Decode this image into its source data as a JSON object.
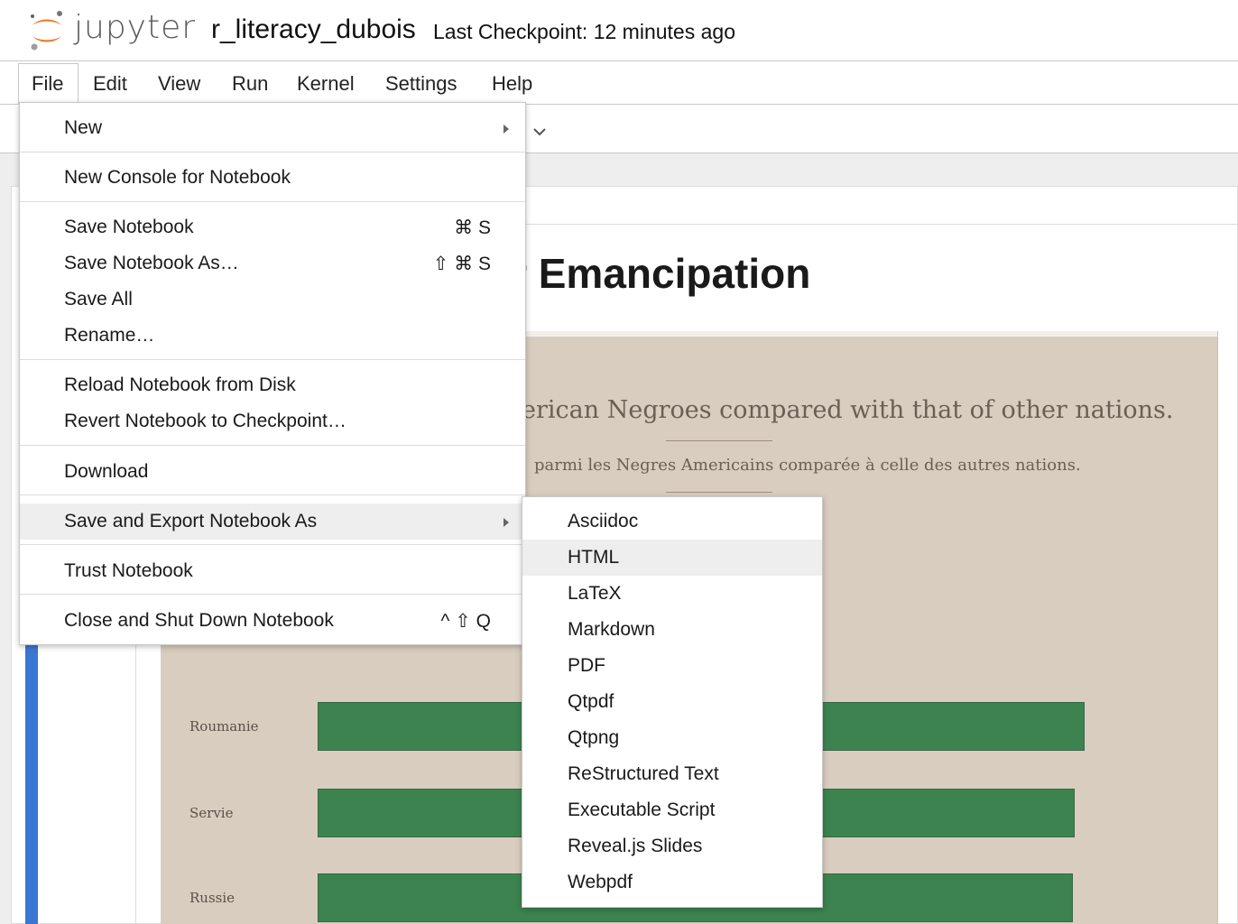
{
  "header": {
    "logo_text": "jupyter",
    "notebook_title": "r_literacy_dubois",
    "checkpoint": "Last Checkpoint: 12 minutes ago"
  },
  "menubar": {
    "items": [
      "File",
      "Edit",
      "View",
      "Run",
      "Kernel",
      "Settings",
      "Help"
    ],
    "active": "File"
  },
  "notebook": {
    "heading_visible": "teracy After Emancipation",
    "scan": {
      "line1": "erican Negroes compared with that of other nations.",
      "line2": "parmi les Negres Americains comparée à celle des autres nations.",
      "labels": [
        "Roumanie",
        "Servie",
        "Russie"
      ]
    }
  },
  "file_menu": {
    "items": [
      {
        "label": "New",
        "submenu": true
      },
      {
        "label": "New Console for Notebook"
      },
      {
        "label": "Save Notebook",
        "shortcut": "⌘ S"
      },
      {
        "label": "Save Notebook As…",
        "shortcut": "⇧ ⌘ S"
      },
      {
        "label": "Save All"
      },
      {
        "label": "Rename…"
      },
      {
        "label": "Reload Notebook from Disk"
      },
      {
        "label": "Revert Notebook to Checkpoint…"
      },
      {
        "label": "Download"
      },
      {
        "label": "Save and Export Notebook As",
        "submenu": true,
        "active": true
      },
      {
        "label": "Trust Notebook"
      },
      {
        "label": "Close and Shut Down Notebook",
        "shortcut": "^ ⇧ Q"
      }
    ]
  },
  "export_menu": {
    "items": [
      "Asciidoc",
      "HTML",
      "LaTeX",
      "Markdown",
      "PDF",
      "Qtpdf",
      "Qtpng",
      "ReStructured Text",
      "Executable Script",
      "Reveal.js Slides",
      "Webpdf"
    ],
    "highlighted": "HTML"
  },
  "colors": {
    "accent": "#3b76d1",
    "logo_orange": "#f37726",
    "bar_green": "#2f7d47",
    "menu_highlight": "#eeeeee"
  }
}
